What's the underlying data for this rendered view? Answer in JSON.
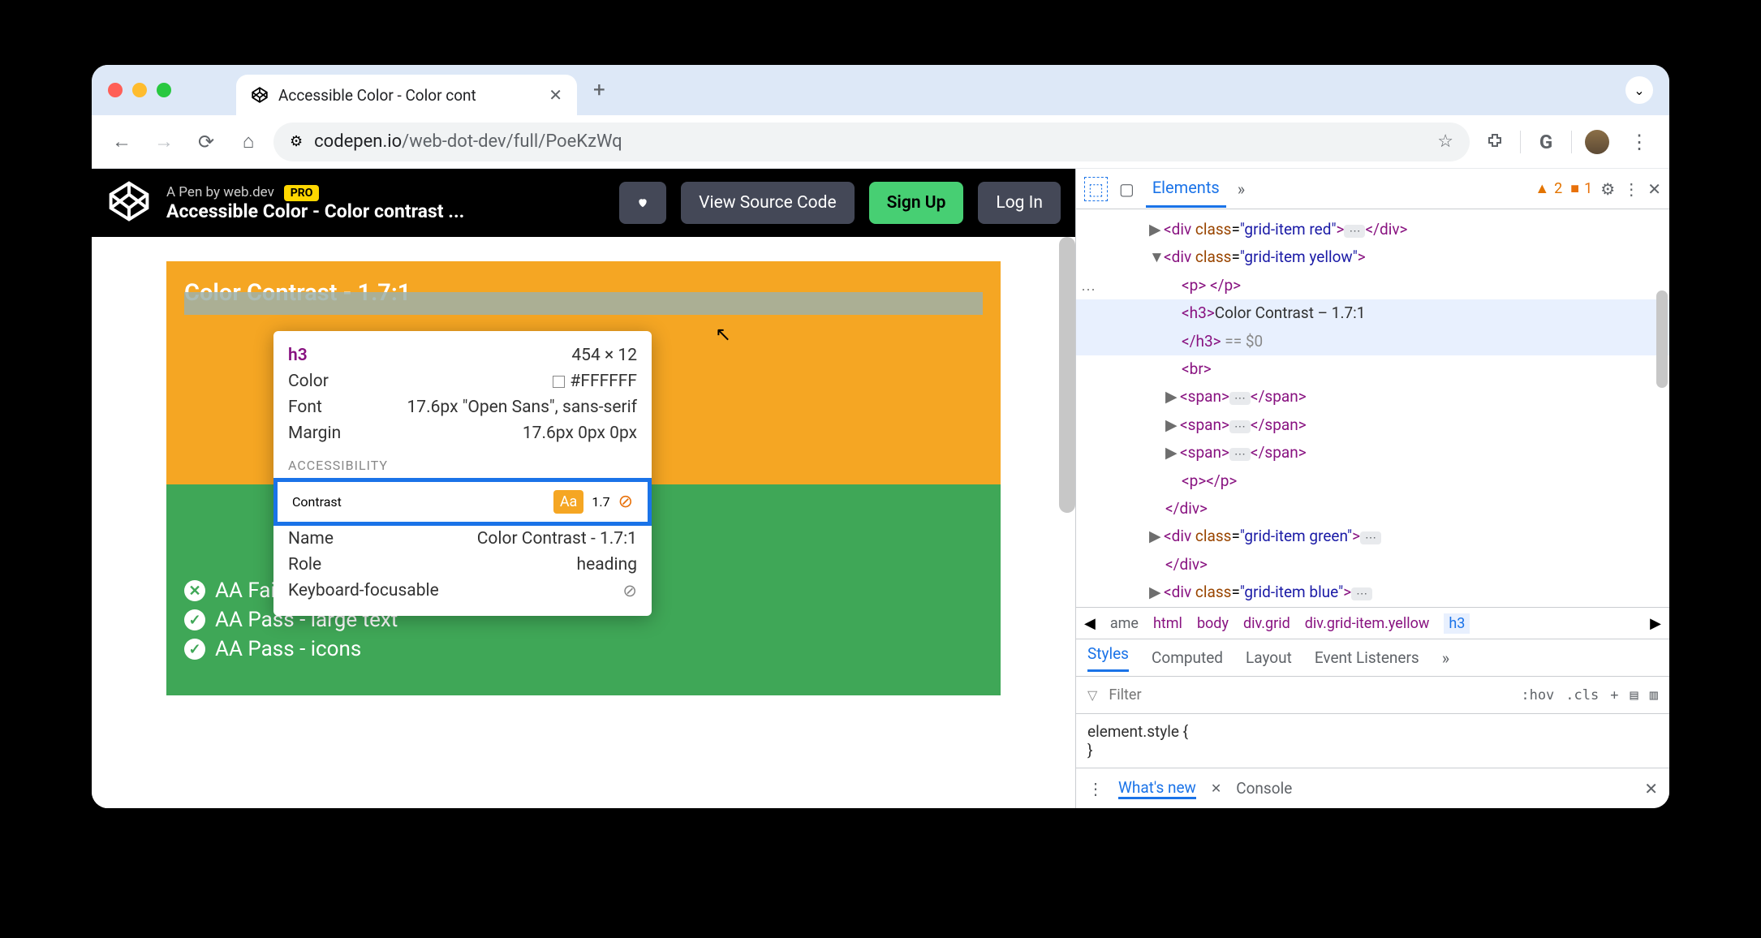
{
  "browser": {
    "tab_title": "Accessible Color - Color cont",
    "url_domain": "codepen.io",
    "url_path": "/web-dot-dev/full/PoeKzWq"
  },
  "codepen": {
    "byline": "A Pen by web.dev",
    "pro": "PRO",
    "title": "Accessible Color - Color contrast ...",
    "view_source": "View Source Code",
    "signup": "Sign Up",
    "login": "Log In"
  },
  "page": {
    "yellow_title": "Color Contrast - 1.7:1",
    "green_items": [
      {
        "icon": "x",
        "text": "AA Fail - regular text"
      },
      {
        "icon": "check",
        "text": "AA Pass - large text"
      },
      {
        "icon": "check",
        "text": "AA Pass - icons"
      }
    ]
  },
  "tooltip": {
    "tag": "h3",
    "dims": "454 × 12",
    "rows": [
      {
        "label": "Color",
        "value": "#FFFFFF"
      },
      {
        "label": "Font",
        "value": "17.6px \"Open Sans\", sans-serif"
      },
      {
        "label": "Margin",
        "value": "17.6px 0px 0px"
      }
    ],
    "acc_header": "ACCESSIBILITY",
    "contrast_label": "Contrast",
    "contrast_aa": "Aa",
    "contrast_val": "1.7",
    "name_label": "Name",
    "name_val": "Color Contrast - 1.7:1",
    "role_label": "Role",
    "role_val": "heading",
    "kb_label": "Keyboard-focusable"
  },
  "devtools": {
    "tab_elements": "Elements",
    "warn_count": "2",
    "issue_count": "1",
    "elements": {
      "line1": "<div class=\"grid-item red\">",
      "line2": "<div class=\"grid-item yellow\">",
      "line3": "<p> </p>",
      "line4_tag": "h3",
      "line4_text": "Color Contrast – 1.7:1",
      "line5": "</h3>",
      "line5_var": " == $0",
      "line6": "<br>",
      "line7": "<span>",
      "line7b": "</span>",
      "line10": "<p></p>",
      "line11": "</div>",
      "line12": "<div class=\"grid-item green\">",
      "line13": "</div>",
      "line14": "<div class=\"grid-item blue\">"
    },
    "crumbs": [
      "ame",
      "html",
      "body",
      "div.grid",
      "div.grid-item.yellow",
      "h3"
    ],
    "style_tabs": [
      "Styles",
      "Computed",
      "Layout",
      "Event Listeners"
    ],
    "filter_placeholder": "Filter",
    "hov": ":hov",
    "cls": ".cls",
    "element_style": "element.style {",
    "brace": "}",
    "drawer_tabs": [
      "What's new",
      "Console"
    ]
  }
}
